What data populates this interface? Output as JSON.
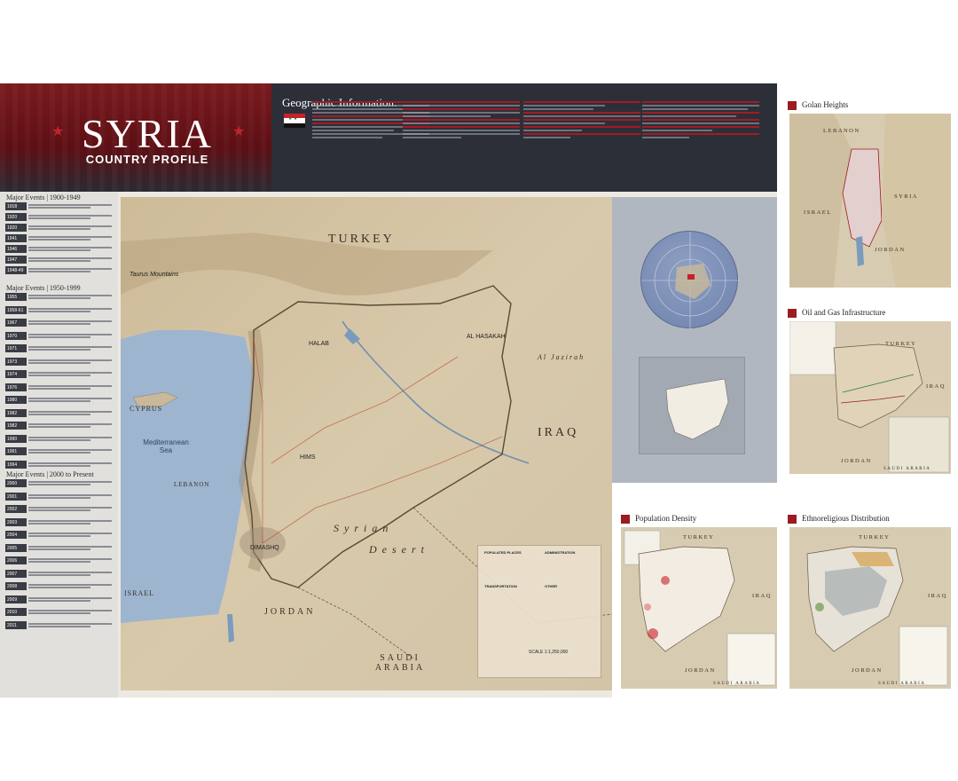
{
  "header": {
    "title": "SYRIA",
    "subtitle": "COUNTRY PROFILE",
    "geo_title": "Geographic Information:"
  },
  "colors": {
    "brand_red": "#a41b24",
    "band_dark": "#2c2f38",
    "water": "#9db5cf",
    "land": "#d6c8ad"
  },
  "events": {
    "sections": [
      {
        "title": "Major Events | 1900-1949",
        "years": [
          "1918",
          "1920",
          "1920",
          "1941",
          "1946",
          "1947",
          "1948-49"
        ]
      },
      {
        "title": "Major Events | 1950-1999",
        "years": [
          "1955",
          "1958-61",
          "1967",
          "1970",
          "1971",
          "1973",
          "1974",
          "1976",
          "1980",
          "1982",
          "1982",
          "1990",
          "1991",
          "1994"
        ]
      },
      {
        "title": "Major Events | 2000 to Present",
        "years": [
          "2000",
          "2001",
          "2002",
          "2003",
          "2004",
          "2005",
          "2006",
          "2007",
          "2008",
          "2009",
          "2010",
          "2011"
        ]
      }
    ]
  },
  "main_map": {
    "countries": {
      "turkey": "TURKEY",
      "iraq": "IRAQ",
      "lebanon": "LEBANON",
      "jordan": "JORDAN",
      "israel": "ISRAEL",
      "saudi": "SAUDI ARABIA",
      "cyprus": "CYPRUS"
    },
    "regions": {
      "desert1": "Syrian",
      "desert2": "Desert",
      "jazirah": "Al Jazirah",
      "taurus": "Taurus Mountains"
    },
    "sea": {
      "line1": "Mediterranean",
      "line2": "Sea"
    },
    "cities": {
      "halab": "HALAB",
      "hims": "HIMS",
      "hasakah": "AL HASAKAH",
      "dimashq": "DIMASHQ"
    },
    "legend": {
      "places": "POPULATED PLACES",
      "admin": "ADMINISTRATION",
      "transport": "TRANSPORTATION",
      "other": "OTHER",
      "scale": "SCALE 1:1,250,000"
    }
  },
  "panels": {
    "golan": {
      "title": "Golan Heights",
      "labels": {
        "lebanon": "LEBANON",
        "syria": "SYRIA",
        "israel": "ISRAEL",
        "jordan": "JORDAN"
      }
    },
    "oil": {
      "title": "Oil and Gas Infrastructure",
      "labels": {
        "turkey": "TURKEY",
        "iraq": "IRAQ",
        "jordan": "JORDAN",
        "saudi": "SAUDI ARABIA"
      }
    },
    "population": {
      "title": "Population Density",
      "labels": {
        "turkey": "TURKEY",
        "iraq": "IRAQ",
        "jordan": "JORDAN",
        "saudi": "SAUDI ARABIA"
      }
    },
    "ethno": {
      "title": "Ethnoreligious Distribution",
      "labels": {
        "turkey": "TURKEY",
        "iraq": "IRAQ",
        "jordan": "JORDAN",
        "saudi": "SAUDI ARABIA"
      }
    }
  }
}
